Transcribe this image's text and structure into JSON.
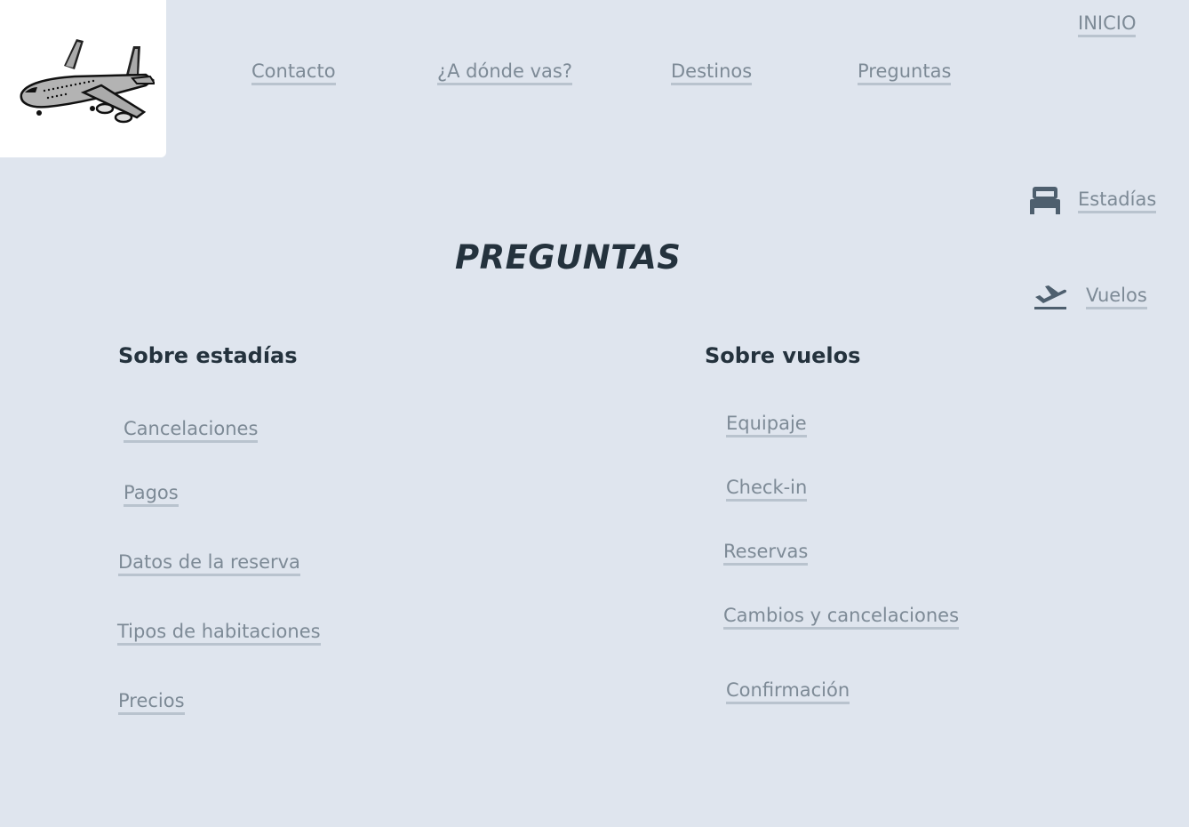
{
  "header": {
    "inicio": "INICIO",
    "nav": {
      "contacto": "Contacto",
      "adonde": "¿A dónde vas?",
      "destinos": "Destinos",
      "preguntas": "Preguntas"
    }
  },
  "side_nav": {
    "estadias": {
      "label": "Estadías",
      "icon": "bed-icon"
    },
    "vuelos": {
      "label": "Vuelos",
      "icon": "airplane-takeoff-icon"
    }
  },
  "main": {
    "title": "PREGUNTAS",
    "estadias_section": {
      "heading": "Sobre estadías",
      "links": [
        "Cancelaciones",
        "Pagos",
        "Datos de la reserva",
        "Tipos de habitaciones",
        "Precios"
      ]
    },
    "vuelos_section": {
      "heading": "Sobre vuelos",
      "links": [
        "Equipaje",
        "Check-in",
        "Reservas",
        "Cambios y cancelaciones",
        "Confirmación"
      ]
    }
  },
  "colors": {
    "background": "#dfe5ee",
    "link": "#7d8a96",
    "link_underline": "#b9c3ce",
    "heading": "#24323d",
    "icon": "#4e5f6e"
  }
}
